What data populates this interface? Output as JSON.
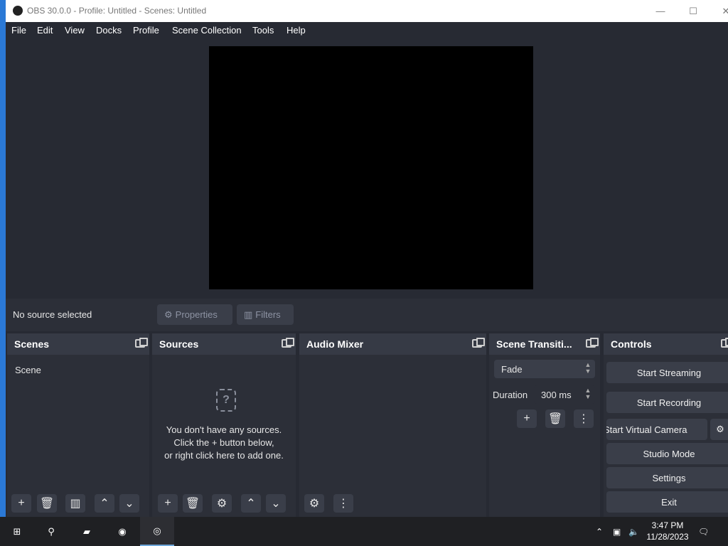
{
  "window": {
    "title": "OBS 30.0.0 - Profile: Untitled - Scenes: Untitled",
    "minimize": "—",
    "maximize": "☐",
    "close": "✕"
  },
  "menu": [
    "File",
    "Edit",
    "View",
    "Docks",
    "Profile",
    "Scene Collection",
    "Tools",
    "Help"
  ],
  "source_bar": {
    "no_source": "No source selected",
    "properties": "Properties",
    "filters": "Filters"
  },
  "docks": {
    "scenes": {
      "title": "Scenes",
      "items": [
        "Scene"
      ]
    },
    "sources": {
      "title": "Sources",
      "empty_line1": "You don't have any sources.",
      "empty_line2": "Click the + button below,",
      "empty_line3": "or right click here to add one."
    },
    "mixer": {
      "title": "Audio Mixer"
    },
    "transitions": {
      "title": "Scene Transiti...",
      "transition": "Fade",
      "duration_label": "Duration",
      "duration_value": "300 ms"
    },
    "controls": {
      "title": "Controls",
      "start_streaming": "Start Streaming",
      "start_recording": "Start Recording",
      "start_virtual_camera": "Start Virtual Camera",
      "studio_mode": "Studio Mode",
      "settings": "Settings",
      "exit": "Exit"
    }
  },
  "taskbar": {
    "time": "3:47 PM",
    "date": "11/28/2023"
  },
  "colors": {
    "accent": "#2b79d6",
    "background": "#272a33",
    "panel": "#2c2f38",
    "button": "#3a3e49"
  }
}
